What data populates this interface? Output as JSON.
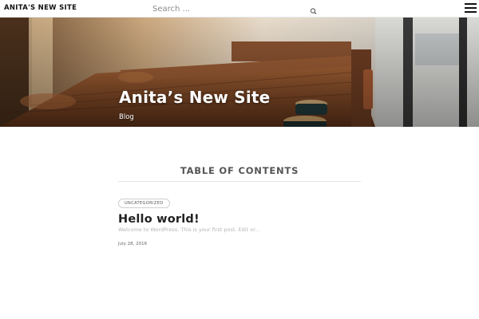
{
  "header": {
    "site_name": "ANITA'S NEW SITE",
    "search": {
      "placeholder": "Search ..."
    },
    "icons": {
      "search": "search-icon",
      "menu": "hamburger-menu-icon"
    }
  },
  "hero": {
    "title": "Anita’s New Site",
    "nav_link": "Blog"
  },
  "main": {
    "section_title": "TABLE OF CONTENTS",
    "posts": [
      {
        "category": "UNCATEGORIZED",
        "title": "Hello world!",
        "excerpt": "Welcome to WordPress. This is your first post. Edit or...",
        "date": "July 28, 2016"
      }
    ]
  },
  "colors": {
    "text_dark": "#222222",
    "text_muted": "#b5b5b5",
    "divider": "#e4e4e4"
  }
}
